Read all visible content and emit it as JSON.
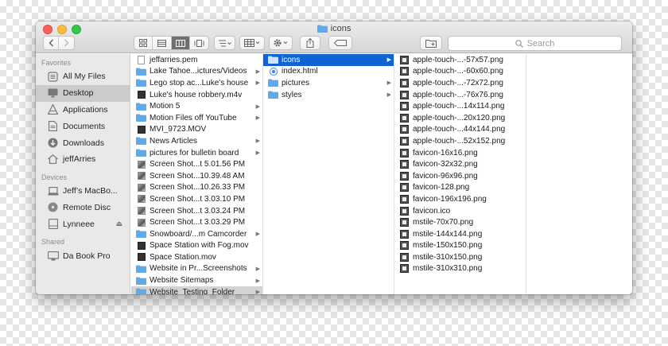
{
  "window": {
    "title": "icons"
  },
  "toolbar": {
    "search_placeholder": "Search",
    "back_icon": "chevron-left-icon",
    "forward_icon": "chevron-right-icon"
  },
  "sidebar": {
    "favorites_heading": "Favorites",
    "favorites": [
      {
        "label": "All My Files",
        "icon": "all-files-icon"
      },
      {
        "label": "Desktop",
        "icon": "desktop-icon",
        "selected": true
      },
      {
        "label": "Applications",
        "icon": "applications-icon"
      },
      {
        "label": "Documents",
        "icon": "documents-icon"
      },
      {
        "label": "Downloads",
        "icon": "downloads-icon"
      },
      {
        "label": "jeffArries",
        "icon": "home-icon"
      }
    ],
    "devices_heading": "Devices",
    "devices": [
      {
        "label": "Jeff’s MacBo...",
        "icon": "laptop-icon"
      },
      {
        "label": "Remote Disc",
        "icon": "disc-icon"
      },
      {
        "label": "Lynneee",
        "icon": "drive-icon",
        "eject": true
      }
    ],
    "shared_heading": "Shared",
    "shared": [
      {
        "label": "Da Book Pro",
        "icon": "computer-icon"
      }
    ]
  },
  "columns": {
    "desktop": [
      {
        "name": "jeffarries.pem",
        "type": "file"
      },
      {
        "name": "Lake Tahoe...ictures/Videos",
        "type": "folder",
        "arrow": true
      },
      {
        "name": "Lego stop ac...Luke's house",
        "type": "folder",
        "arrow": true
      },
      {
        "name": "Luke's house robbery.m4v",
        "type": "video"
      },
      {
        "name": "Motion 5",
        "type": "folder",
        "arrow": true
      },
      {
        "name": "Motion Files off YouTube",
        "type": "folder",
        "arrow": true
      },
      {
        "name": "MVI_9723.MOV",
        "type": "video"
      },
      {
        "name": "News Articles",
        "type": "folder",
        "arrow": true
      },
      {
        "name": "pictures for bulletin board",
        "type": "folder",
        "arrow": true
      },
      {
        "name": "Screen Shot...t 5.01.56 PM",
        "type": "screenshot"
      },
      {
        "name": "Screen Shot...10.39.48 AM",
        "type": "screenshot"
      },
      {
        "name": "Screen Shot...10.26.33 PM",
        "type": "screenshot"
      },
      {
        "name": "Screen Shot...t 3.03.10 PM",
        "type": "screenshot"
      },
      {
        "name": "Screen Shot...t 3.03.24 PM",
        "type": "screenshot"
      },
      {
        "name": "Screen Shot...t 3.03.29 PM",
        "type": "screenshot"
      },
      {
        "name": "Snowboard/...m Camcorder",
        "type": "folder",
        "arrow": true
      },
      {
        "name": "Space Station with Fog.mov",
        "type": "video"
      },
      {
        "name": "Space Station.mov",
        "type": "video"
      },
      {
        "name": "Website in Pr...Screenshots",
        "type": "folder",
        "arrow": true
      },
      {
        "name": "Website Sitemaps",
        "type": "folder",
        "arrow": true
      },
      {
        "name": "Website_Testing_Folder",
        "type": "folder",
        "arrow": true,
        "selected": "gray"
      }
    ],
    "website_testing": [
      {
        "name": "icons",
        "type": "folder",
        "arrow": true,
        "selected": "blue"
      },
      {
        "name": "index.html",
        "type": "html"
      },
      {
        "name": "pictures",
        "type": "folder",
        "arrow": true
      },
      {
        "name": "styles",
        "type": "folder",
        "arrow": true
      }
    ],
    "icons": [
      {
        "name": "apple-touch-...-57x57.png"
      },
      {
        "name": "apple-touch-...-60x60.png"
      },
      {
        "name": "apple-touch-...-72x72.png"
      },
      {
        "name": "apple-touch-...-76x76.png"
      },
      {
        "name": "apple-touch-...14x114.png"
      },
      {
        "name": "apple-touch-...20x120.png"
      },
      {
        "name": "apple-touch-...44x144.png"
      },
      {
        "name": "apple-touch-...52x152.png"
      },
      {
        "name": "favicon-16x16.png"
      },
      {
        "name": "favicon-32x32.png"
      },
      {
        "name": "favicon-96x96.png"
      },
      {
        "name": "favicon-128.png"
      },
      {
        "name": "favicon-196x196.png"
      },
      {
        "name": "favicon.ico"
      },
      {
        "name": "mstile-70x70.png"
      },
      {
        "name": "mstile-144x144.png"
      },
      {
        "name": "mstile-150x150.png"
      },
      {
        "name": "mstile-310x150.png"
      },
      {
        "name": "mstile-310x310.png"
      }
    ]
  },
  "colors": {
    "selection_blue": "#0f63d5",
    "folder_blue": "#62a9e7",
    "close": "#fc605c",
    "minimize": "#fdbc40",
    "maximize": "#34c84a"
  }
}
